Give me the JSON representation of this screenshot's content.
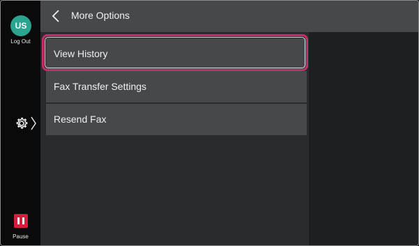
{
  "sidebar": {
    "user_initials": "US",
    "logout_label": "Log Out",
    "pause_label": "Pause",
    "settings_icon": "gear-icon",
    "expand_icon": "chevron-right-icon"
  },
  "header": {
    "title": "More Options",
    "back_icon": "chevron-left-icon"
  },
  "menu": {
    "items": [
      {
        "label": "View History",
        "selected": true
      },
      {
        "label": "Fax Transfer Settings",
        "selected": false
      },
      {
        "label": "Resend Fax",
        "selected": false
      }
    ]
  },
  "colors": {
    "avatar": "#2aa38f",
    "pause": "#d21f3c",
    "selection": "#c22f6a",
    "header": "#46484b"
  }
}
